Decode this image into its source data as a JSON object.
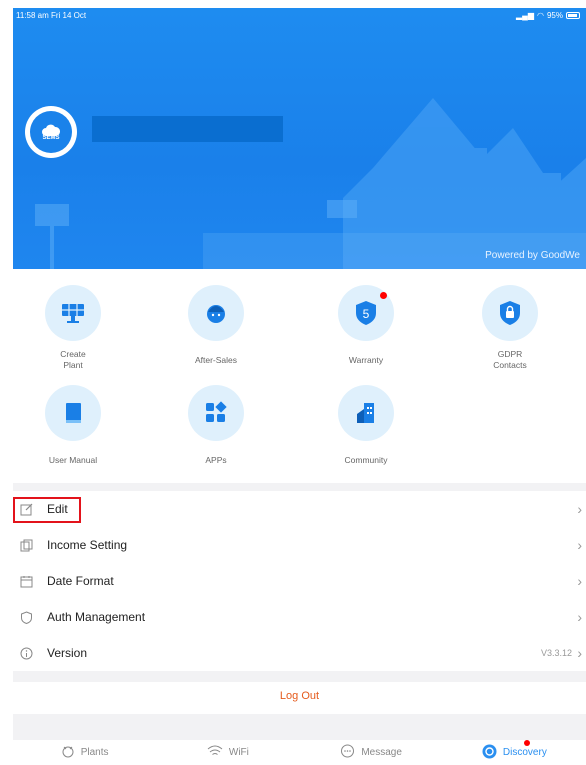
{
  "status_bar": {
    "time": "11:58 am  Fri 14 Oct",
    "battery": "95%"
  },
  "header": {
    "avatar_text": "SEMS",
    "powered_by": "Powered by GoodWe"
  },
  "grid": [
    {
      "label": "Create\nPlant",
      "icon": "solar-panel-icon"
    },
    {
      "label": "After-Sales",
      "icon": "headset-agent-icon"
    },
    {
      "label": "Warranty",
      "icon": "warranty-shield-icon",
      "badge": true
    },
    {
      "label": "GDPR\nContacts",
      "icon": "lock-shield-icon"
    },
    {
      "label": "User Manual",
      "icon": "book-icon"
    },
    {
      "label": "APPs",
      "icon": "apps-grid-icon"
    },
    {
      "label": "Community",
      "icon": "building-icon"
    }
  ],
  "menu": {
    "edit": "Edit",
    "income": "Income Setting",
    "date_format": "Date Format",
    "auth": "Auth Management",
    "version": "Version",
    "version_value": "V3.3.12"
  },
  "logout": "Log Out",
  "tabs": {
    "plants": "Plants",
    "wifi": "WiFi",
    "message": "Message",
    "discovery": "Discovery"
  },
  "colors": {
    "accent": "#1f86ef",
    "logout": "#e55b1d",
    "highlight": "#e3131b"
  }
}
